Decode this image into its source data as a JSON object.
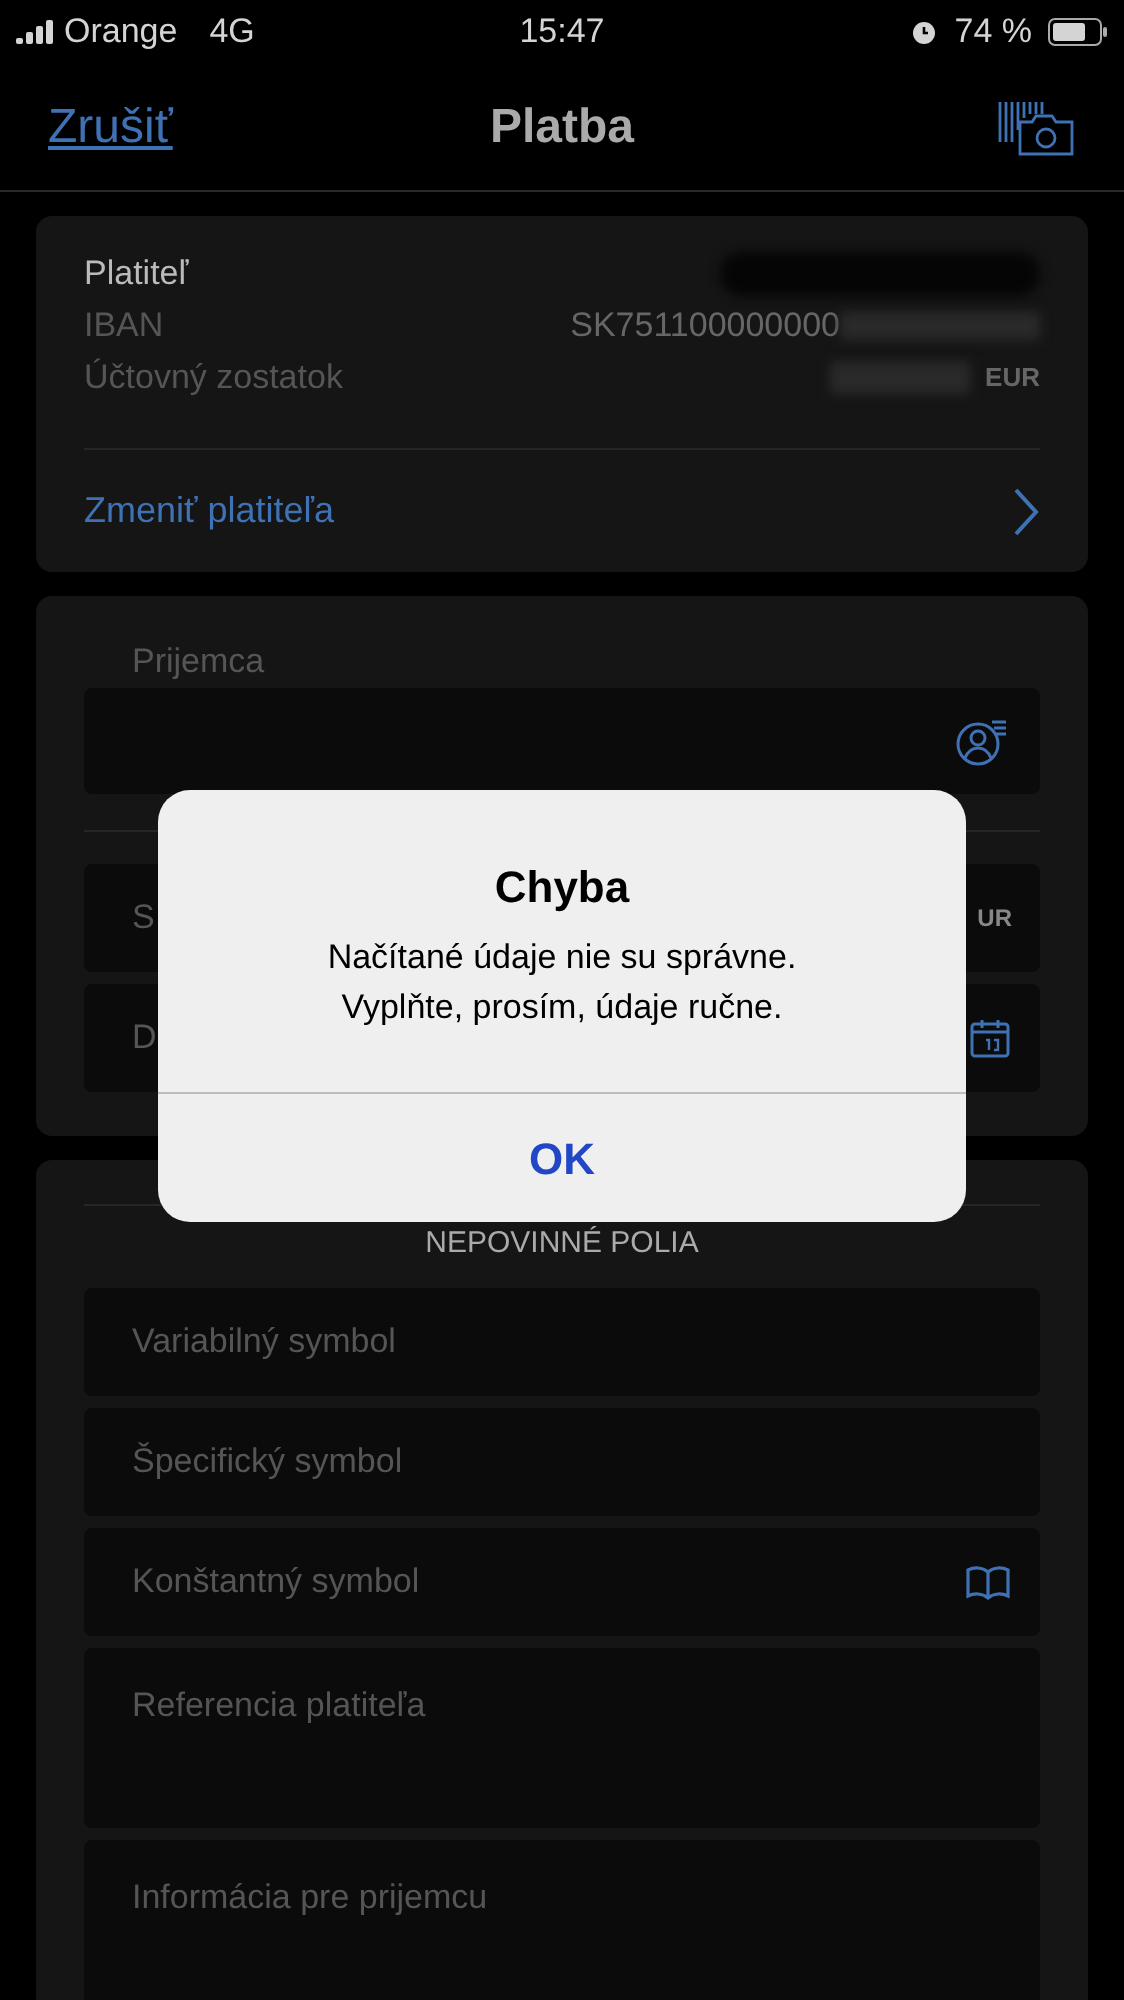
{
  "status_bar": {
    "carrier": "Orange",
    "network": "4G",
    "time": "15:47",
    "battery": "74 %"
  },
  "nav": {
    "cancel": "Zrušiť",
    "title": "Platba"
  },
  "payer": {
    "label": "Platiteľ",
    "iban_label": "IBAN",
    "iban": "SK751100000000",
    "balance_label": "Účtovný zostatok",
    "currency": "EUR",
    "change_link": "Zmeniť platiteľa"
  },
  "recipient": {
    "label": "Prijemca"
  },
  "covered_fields": [
    {
      "label": "S",
      "suffix": "UR",
      "kind": "amount"
    },
    {
      "label": "D",
      "kind": "date"
    }
  ],
  "optional": {
    "heading": "NEPOVINNÉ POLIA",
    "fields": [
      {
        "placeholder": "Variabilný symbol",
        "kind": "single"
      },
      {
        "placeholder": "Špecifický symbol",
        "kind": "single"
      },
      {
        "placeholder": "Konštantný symbol",
        "kind": "lookup"
      },
      {
        "placeholder": "Referencia platiteľa",
        "kind": "multiline"
      },
      {
        "placeholder": "Informácia pre prijemcu",
        "kind": "multiline"
      }
    ]
  },
  "dialog": {
    "title": "Chyba",
    "message_lines": [
      "Načítané údaje nie su správne.",
      "Vyplňte, prosím, údaje ručne."
    ],
    "button": "OK"
  }
}
